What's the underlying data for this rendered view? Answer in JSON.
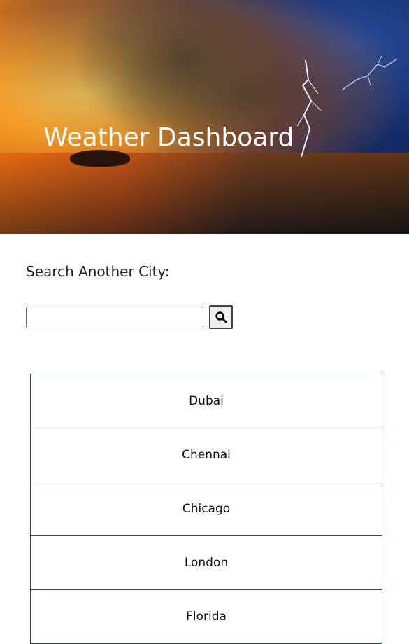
{
  "header": {
    "title": "Weather Dashboard"
  },
  "search": {
    "label": "Search Another City:",
    "value": "",
    "placeholder": "",
    "button_icon": "search-icon"
  },
  "cities": [
    {
      "name": "Dubai"
    },
    {
      "name": "Chennai"
    },
    {
      "name": "Chicago"
    },
    {
      "name": "London"
    },
    {
      "name": "Florida"
    }
  ],
  "colors": {
    "city_border": "#2f4a4a",
    "title_text": "#ffffff"
  }
}
